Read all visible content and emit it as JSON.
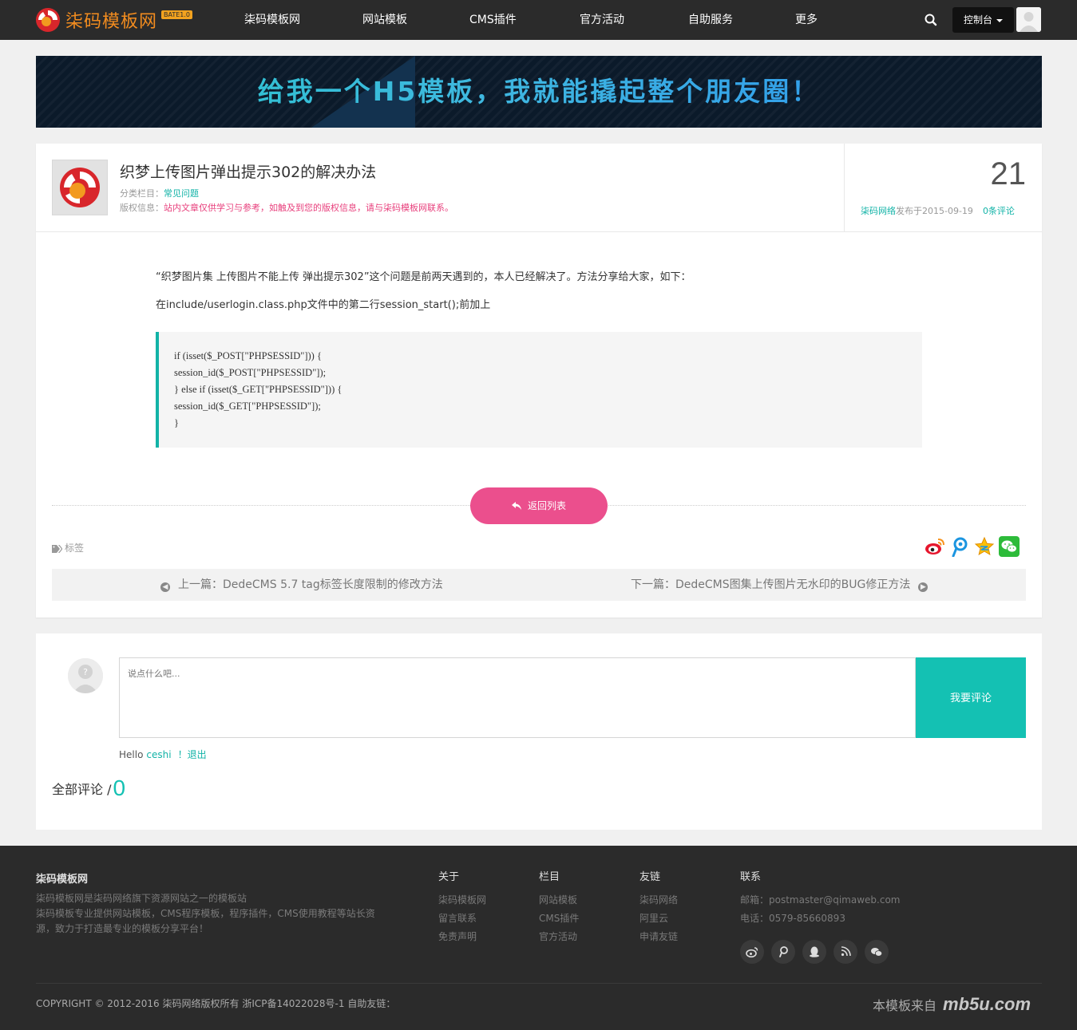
{
  "header": {
    "logo_text": "柒码模板网",
    "logo_badge": "BATE1.0",
    "nav": [
      "柒码模板网",
      "网站模板",
      "CMS插件",
      "官方活动",
      "自助服务",
      "更多"
    ],
    "console_label": "控制台",
    "icons": {
      "search": "search-icon",
      "avatar": "avatar-icon"
    }
  },
  "banner": {
    "text": "给我一个H5模板，我就能撬起整个朋友圈！"
  },
  "article": {
    "title": "织梦上传图片弹出提示302的解决办法",
    "category_label": "分类栏目：",
    "category_value": "常见问题",
    "copyright_label": "版权信息：",
    "copyright_value": "站内文章仅供学习与参考，如触及到您的版权信息，请与柒码模板网联系。",
    "day": "21",
    "publisher": "柒码网络",
    "published_on": "发布于2015-09-19",
    "comments_count": "0条评论",
    "paragraph1": "“织梦图片集 上传图片不能上传 弹出提示302”这个问题是前两天遇到的，本人已经解决了。方法分享给大家，如下：",
    "paragraph2": "在include/userlogin.class.php文件中的第二行session_start();前加上",
    "code_lines": [
      "if (isset($_POST[\"PHPSESSID\"])) {",
      "session_id($_POST[\"PHPSESSID\"]);",
      "} else if (isset($_GET[\"PHPSESSID\"])) {",
      "session_id($_GET[\"PHPSESSID\"]);",
      "}"
    ],
    "back_label": "返回列表",
    "tags_label": "标签",
    "share_icons": [
      "weibo-icon",
      "tencent-weibo-icon",
      "qzone-icon",
      "wechat-icon"
    ],
    "prev_label": "上一篇：DedeCMS 5.7 tag标签长度限制的修改方法",
    "next_label": "下一篇：DedeCMS图集上传图片无水印的BUG修正方法"
  },
  "comments": {
    "placeholder": "说点什么吧...",
    "submit_label": "我要评论",
    "hello": "Hello",
    "username": "ceshi",
    "logout": "！退出",
    "total_label": "全部评论 /",
    "total_count": "0"
  },
  "footer": {
    "brand": "柒码模板网",
    "desc": "柒码模板网是柒码网络旗下资源网站之一的模板站\n柒码模板专业提供网站模板，CMS程序模板，程序插件，CMS使用教程等站长资源，致力于打造最专业的模板分享平台！",
    "columns": [
      {
        "title": "关于",
        "items": [
          "柒码模板网",
          "留言联系",
          "免责声明"
        ]
      },
      {
        "title": "栏目",
        "items": [
          "网站模板",
          "CMS插件",
          "官方活动"
        ]
      },
      {
        "title": "友链",
        "items": [
          "柒码网络",
          "阿里云",
          "申请友链"
        ]
      },
      {
        "title": "联系",
        "items": [
          "邮箱：postmaster@qimaweb.com",
          "电话：0579-85660893"
        ]
      }
    ],
    "social_icons": [
      "weibo-icon",
      "tencent-weibo-icon",
      "qq-icon",
      "rss-icon",
      "wechat-icon"
    ],
    "copyright": "COPYRIGHT © 2012-2016 柒码网络版权所有 浙ICP备14022028号-1 自助友链：",
    "template_from": "本模板来自",
    "template_brand": "mb5u.com"
  },
  "colors": {
    "accent_teal": "#14c1b3",
    "accent_pink": "#eb4f8d",
    "header_bg": "#2b2b2b",
    "logo_orange": "#f28c1f"
  }
}
